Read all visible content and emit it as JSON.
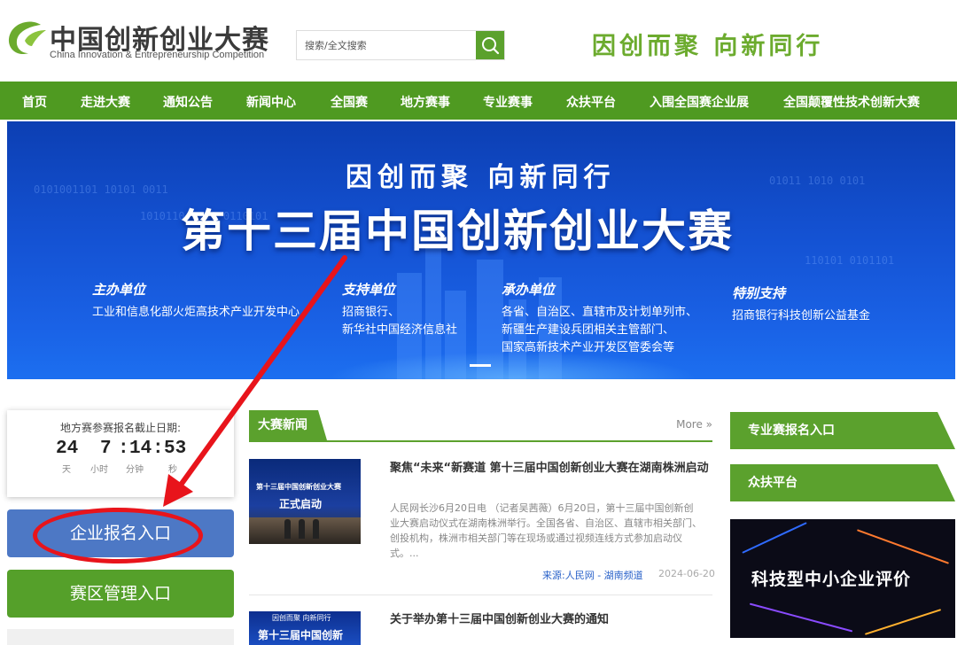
{
  "header": {
    "logo_cn": "中国创新创业大赛",
    "logo_en": "China Innovation & Entrepreneurship Competition",
    "search_placeholder": "搜索/全文搜索",
    "search_icon": "search-icon",
    "slogan": "因创而聚 向新同行"
  },
  "nav": {
    "items": [
      "首页",
      "走进大赛",
      "通知公告",
      "新闻中心",
      "全国赛",
      "地方赛事",
      "专业赛事",
      "众扶平台",
      "入围全国赛企业展",
      "全国颠覆性技术创新大赛"
    ]
  },
  "banner": {
    "slogan": "因创而聚 向新同行",
    "title": "第十三届中国创新创业大赛",
    "organizer_label": "主办单位",
    "organizer": "工业和信息化部火炬高技术产业开发中心",
    "supporter_label": "支持单位",
    "supporters": [
      "招商银行、",
      "新华社中国经济信息社"
    ],
    "host_label": "承办单位",
    "hosts": [
      "各省、自治区、直辖市及计划单列市、",
      "新疆生产建设兵团相关主管部门、",
      "国家高新技术产业开发区管委会等"
    ],
    "special_label": "特别支持",
    "special": "招商银行科技创新公益基金"
  },
  "countdown": {
    "label": "地方赛参赛报名截止日期:",
    "days": "24",
    "hours": "7",
    "minutes": "14",
    "seconds": "53",
    "sep1": ":",
    "sep2": ":",
    "unit_days": "天",
    "unit_hours": "小时",
    "unit_minutes": "分钟",
    "unit_seconds": "秒"
  },
  "left_buttons": {
    "enterprise": "企业报名入口",
    "region": "赛区管理入口"
  },
  "news": {
    "tab": "大赛新闻",
    "more": "More »",
    "items": [
      {
        "title": "聚焦“未来“新赛道 第十三届中国创新创业大赛在湖南株洲启动",
        "summary": "人民网长沙6月20日电 （记者吴茜薇）6月20日，第十三届中国创新创业大赛启动仪式在湖南株洲举行。全国各省、自治区、直辖市相关部门、创投机构，株洲市相关部门等在现场或通过视频连线方式参加启动仪式。...",
        "source": "来源:人民网 - 湖南频道",
        "date": "2024-06-20",
        "thumb_line1": "第十三届中国创新创业大赛",
        "thumb_line2": "正式启动"
      },
      {
        "title": "关于举办第十三届中国创新创业大赛的通知",
        "thumb_line1": "因创而聚 向新同行",
        "thumb_line2": "第十三届中国创新"
      }
    ]
  },
  "right": {
    "btn_professional": "专业赛报名入口",
    "btn_platform": "众扶平台",
    "promo_text": "科技型中小企业评价"
  },
  "colors": {
    "nav_green": "#4f9a21",
    "accent_green": "#5ba12d",
    "enterprise_blue": "#4d78c5",
    "annotation_red": "#e8141b"
  }
}
